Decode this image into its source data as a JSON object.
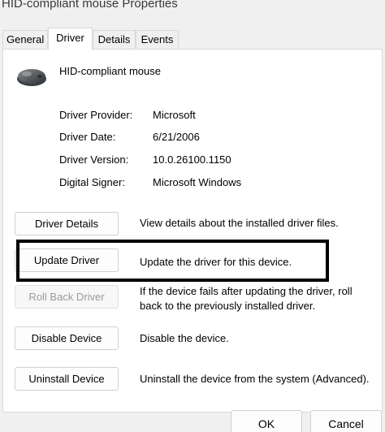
{
  "window": {
    "title": "HID-compliant mouse Properties"
  },
  "tabs": [
    {
      "label": "General",
      "active": false
    },
    {
      "label": "Driver",
      "active": true
    },
    {
      "label": "Details",
      "active": false
    },
    {
      "label": "Events",
      "active": false
    }
  ],
  "device": {
    "name": "HID-compliant mouse",
    "icon": "mouse-icon"
  },
  "properties": [
    {
      "label": "Driver Provider:",
      "value": "Microsoft"
    },
    {
      "label": "Driver Date:",
      "value": "6/21/2006"
    },
    {
      "label": "Driver Version:",
      "value": "10.0.26100.1150"
    },
    {
      "label": "Digital Signer:",
      "value": "Microsoft Windows"
    }
  ],
  "actions": [
    {
      "button": "Driver Details",
      "description": "View details about the installed driver files.",
      "enabled": true
    },
    {
      "button": "Update Driver",
      "description": "Update the driver for this device.",
      "enabled": true
    },
    {
      "button": "Roll Back Driver",
      "description": "If the device fails after updating the driver, roll back to the previously installed driver.",
      "enabled": false
    },
    {
      "button": "Disable Device",
      "description": "Disable the device.",
      "enabled": true
    },
    {
      "button": "Uninstall Device",
      "description": "Uninstall the device from the system (Advanced).",
      "enabled": true
    }
  ],
  "footer": {
    "ok_label": "OK",
    "cancel_label": "Cancel"
  },
  "colors": {
    "highlight_border": "#000000",
    "disabled_text": "#9a9a9a"
  }
}
